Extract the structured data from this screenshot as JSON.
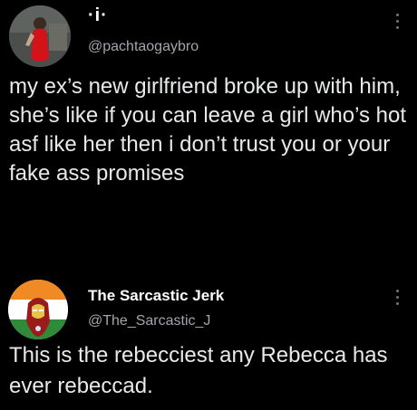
{
  "tweets": [
    {
      "display_name": "·i·",
      "handle": "@pachtaogaybro",
      "text": "my ex’s new girlfriend broke up with him, she’s like if you can leave a girl who’s hot asf like her then i don’t trust you or your fake ass promises",
      "avatar_icon": "profile-photo-woman-red-dress"
    },
    {
      "display_name": "The Sarcastic Jerk",
      "handle": "@The_Sarcastic_J",
      "text": "This is the rebecciest any Rebecca has ever rebeccad.",
      "avatar_icon": "profile-photo-iron-man-flag"
    }
  ],
  "colors": {
    "background": "#000000",
    "text": "#e7e9ea",
    "muted": "#a0a6ab"
  }
}
